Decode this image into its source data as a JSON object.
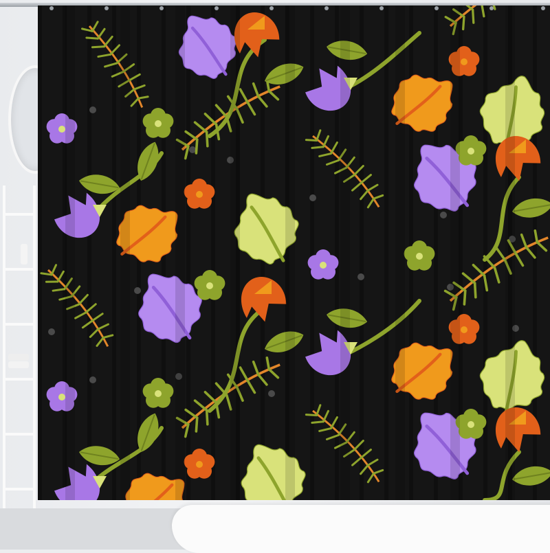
{
  "scene": {
    "subject": "shower-curtain",
    "pattern_colors": {
      "background": "#141414",
      "purple": "#a877e6",
      "orange": "#f09a1c",
      "deep_orange": "#e2601a",
      "lime": "#d9e27a",
      "olive": "#8ea42c",
      "dot": "#4a4a4a"
    }
  }
}
